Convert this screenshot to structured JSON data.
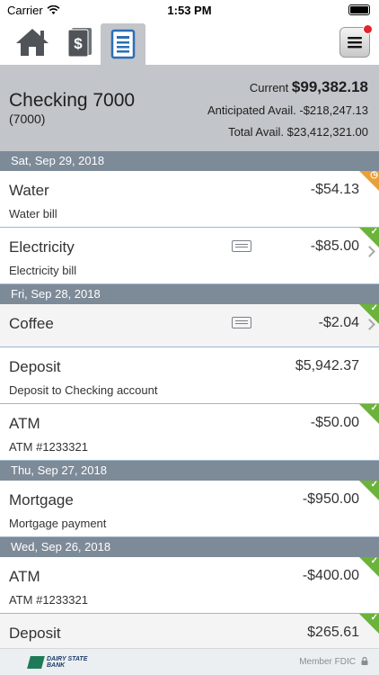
{
  "status_bar": {
    "carrier": "Carrier",
    "time": "1:53 PM"
  },
  "nav": {
    "tabs": [
      {
        "icon": "home-icon"
      },
      {
        "icon": "dollar-cards-icon"
      },
      {
        "icon": "register-icon",
        "active": true
      }
    ],
    "menu_icon": "hamburger-menu-icon",
    "has_notification": true
  },
  "account": {
    "name": "Checking 7000",
    "number": "(7000)",
    "current_label": "Current",
    "current_value": "$99,382.18",
    "anticipated_label": "Anticipated Avail.",
    "anticipated_value": "-$218,247.13",
    "total_label": "Total Avail.",
    "total_value": "$23,412,321.00"
  },
  "transaction_groups": [
    {
      "date": "Sat, Sep 29, 2018",
      "items": [
        {
          "name": "Water",
          "description": "Water bill",
          "amount": "-$54.13",
          "status": "pending",
          "receipt": false,
          "chevron": false
        },
        {
          "name": "Electricity",
          "description": "Electricity bill",
          "amount": "-$85.00",
          "status": "cleared",
          "receipt": true,
          "chevron": true
        }
      ]
    },
    {
      "date": "Fri, Sep 28, 2018",
      "items": [
        {
          "name": "Coffee",
          "description": "",
          "amount": "-$2.04",
          "status": "cleared",
          "receipt": true,
          "chevron": true
        },
        {
          "name": "Deposit",
          "description": "Deposit to Checking account",
          "amount": "$5,942.37",
          "status": "none",
          "receipt": false,
          "chevron": false
        },
        {
          "name": "ATM",
          "description": "ATM #1233321",
          "amount": "-$50.00",
          "status": "cleared",
          "receipt": false,
          "chevron": false
        }
      ]
    },
    {
      "date": "Thu, Sep 27, 2018",
      "items": [
        {
          "name": "Mortgage",
          "description": "Mortgage payment",
          "amount": "-$950.00",
          "status": "cleared",
          "receipt": false,
          "chevron": false
        }
      ]
    },
    {
      "date": "Wed, Sep 26, 2018",
      "items": [
        {
          "name": "ATM",
          "description": "ATM #1233321",
          "amount": "-$400.00",
          "status": "cleared",
          "receipt": false,
          "chevron": false
        },
        {
          "name": "Deposit",
          "description": "",
          "amount": "$265.61",
          "status": "cleared",
          "receipt": false,
          "chevron": false
        }
      ]
    }
  ],
  "footer": {
    "bank_name": "DAIRY STATE BANK",
    "fdic": "Member FDIC"
  },
  "colors": {
    "header_bg": "#c2c5c9",
    "date_bar": "#7d8a98",
    "cleared": "#6bb33a",
    "pending": "#e8a13a",
    "accent": "#2a6fb5"
  }
}
